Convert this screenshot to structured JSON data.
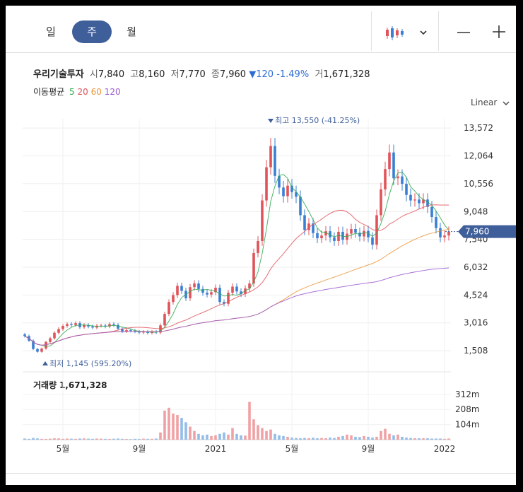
{
  "periods": [
    {
      "label": "일",
      "active": false
    },
    {
      "label": "주",
      "active": true
    },
    {
      "label": "월",
      "active": false
    }
  ],
  "toolbar": {
    "chart_type_icon": "candlestick-icon",
    "dropdown_icon": "chevron-down-icon",
    "zoom_out_icon": "minus-icon",
    "zoom_in_icon": "plus-icon"
  },
  "stock": {
    "name": "우리기술투자",
    "open_label": "시",
    "open": "7,840",
    "high_label": "고",
    "high": "8,160",
    "low_label": "저",
    "low": "7,770",
    "close_label": "종",
    "close": "7,960",
    "change_arrow": "▼",
    "change": "120",
    "change_pct": "-1.49%",
    "volume_label": "거",
    "volume": "1,671,328"
  },
  "moving_average": {
    "label": "이동평균",
    "items": [
      {
        "period": "5",
        "color": "#2fa84f"
      },
      {
        "period": "20",
        "color": "#e0535a"
      },
      {
        "period": "60",
        "color": "#e8973a"
      },
      {
        "period": "120",
        "color": "#9b59d0"
      }
    ]
  },
  "scale_label": "Linear",
  "volume_panel": {
    "label": "거래량",
    "value": "1,671,328"
  },
  "colors": {
    "up": "#e0535a",
    "down": "#3a7fd5",
    "accent": "#3f5f9a",
    "up_vol": "#f0a1a5",
    "down_vol": "#93bde8"
  },
  "chart_data": {
    "type": "candlestick",
    "y_ticks": [
      "13,572",
      "12,064",
      "10,556",
      "9,048",
      "7,540",
      "6,032",
      "4,524",
      "3,016",
      "1,508"
    ],
    "y_tick_values": [
      13572,
      12064,
      10556,
      9048,
      7540,
      6032,
      4524,
      3016,
      1508
    ],
    "ylim": [
      860,
      14460
    ],
    "x_ticks": [
      {
        "label": "5월",
        "index": 9
      },
      {
        "label": "9월",
        "index": 27
      },
      {
        "label": "2021",
        "index": 45
      },
      {
        "label": "5월",
        "index": 63
      },
      {
        "label": "9월",
        "index": 81
      },
      {
        "label": "2022",
        "index": 99
      }
    ],
    "max_annotation": {
      "label": "최고 13,550 (-41.25%)",
      "index": 58,
      "value": 13550
    },
    "min_annotation": {
      "label": "최저 1,145 (595.20%)",
      "index": 3,
      "value": 1145
    },
    "current_price": {
      "label": "7,960",
      "value": 7960
    },
    "volume_ticks": [
      {
        "label": "312m",
        "value": 312
      },
      {
        "label": "208m",
        "value": 208
      },
      {
        "label": "104m",
        "value": 104
      }
    ],
    "volume_max": 360,
    "closes": [
      2300,
      2050,
      1600,
      1450,
      1620,
      1980,
      2180,
      2480,
      2680,
      2850,
      2950,
      2900,
      3000,
      2780,
      2900,
      2820,
      2760,
      2860,
      2870,
      2820,
      2950,
      2900,
      2700,
      2560,
      2620,
      2590,
      2540,
      2490,
      2530,
      2470,
      2540,
      2490,
      2880,
      3500,
      4150,
      4520,
      5020,
      4750,
      4350,
      4950,
      5150,
      4850,
      4650,
      4550,
      4680,
      4920,
      4150,
      4050,
      4650,
      4980,
      4720,
      4580,
      4880,
      5150,
      6800,
      7450,
      9650,
      11450,
      12600,
      10980,
      10350,
      9880,
      10450,
      10100,
      9850,
      8850,
      8050,
      8400,
      7880,
      7600,
      7750,
      7980,
      7650,
      7450,
      7950,
      7520,
      7850,
      8100,
      7900,
      7700,
      8000,
      7650,
      7250,
      8850,
      10250,
      11350,
      12250,
      10850,
      10950,
      10550,
      9950,
      9650,
      9700,
      9500,
      9700,
      9300,
      8750,
      8150,
      7650,
      7750,
      7960
    ],
    "volume": [
      8,
      6,
      12,
      9,
      6,
      5,
      7,
      10,
      9,
      6,
      8,
      7,
      6,
      8,
      9,
      7,
      6,
      8,
      7,
      6,
      5,
      7,
      8,
      6,
      5,
      4,
      6,
      5,
      7,
      6,
      6,
      8,
      50,
      200,
      220,
      180,
      170,
      150,
      120,
      90,
      60,
      40,
      30,
      35,
      25,
      30,
      40,
      50,
      35,
      80,
      40,
      30,
      28,
      260,
      140,
      100,
      80,
      60,
      70,
      40,
      30,
      25,
      20,
      15,
      12,
      10,
      12,
      10,
      14,
      10,
      12,
      10,
      15,
      12,
      20,
      25,
      35,
      30,
      20,
      18,
      25,
      20,
      15,
      20,
      60,
      75,
      40,
      30,
      35,
      20,
      15,
      12,
      10,
      10,
      10,
      10,
      8,
      8,
      8,
      6,
      8
    ]
  }
}
